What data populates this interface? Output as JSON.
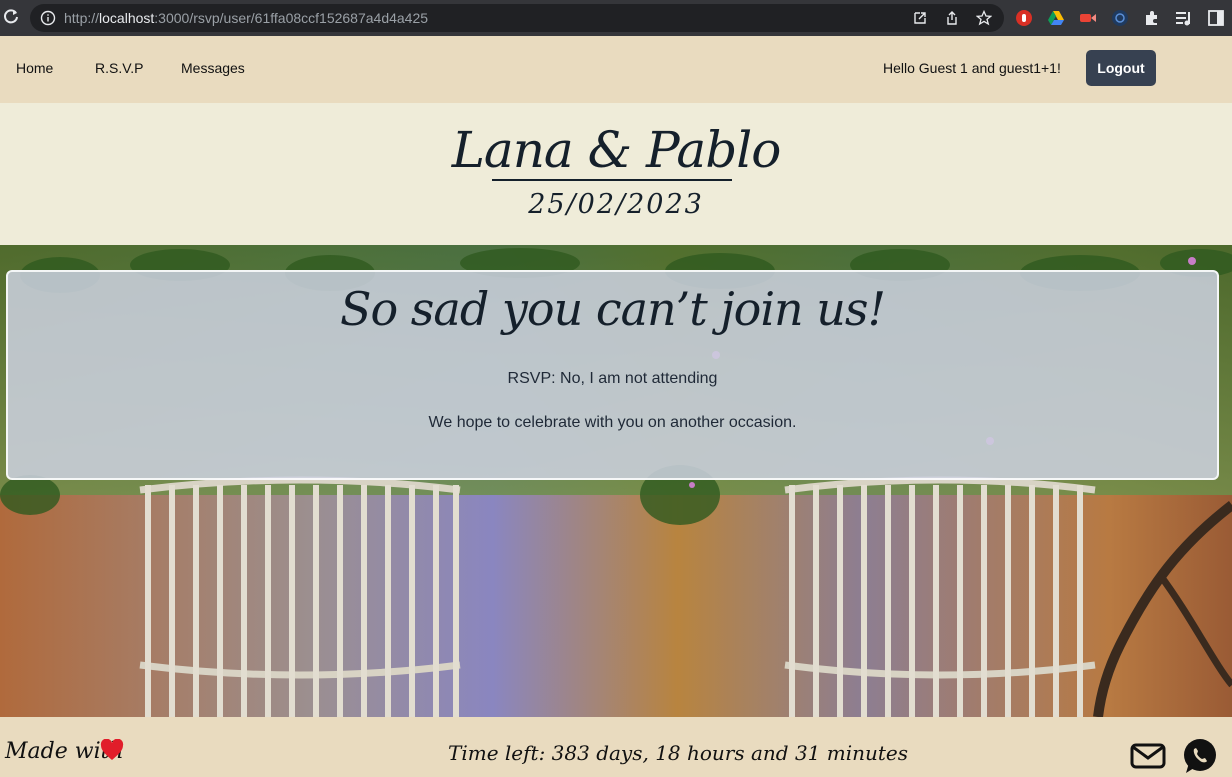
{
  "browser": {
    "url_prefix": "http://",
    "url_host": "localhost",
    "url_rest": ":3000/rsvp/user/61ffa08ccf152687a4d4a425"
  },
  "nav": {
    "links": [
      "Home",
      "R.S.V.P",
      "Messages"
    ],
    "greeting": "Hello Guest 1 and guest1+1!",
    "logout_label": "Logout"
  },
  "header": {
    "couple": "Lana & Pablo",
    "date": "25/02/2023"
  },
  "card": {
    "title": "So sad you can’t join us!",
    "rsvp_status": "RSVP: No, I am not attending",
    "message": "We hope to celebrate with you on another occasion."
  },
  "footer": {
    "made_with": "Made with",
    "time_left": "Time left: 383 days, 18 hours and 31 minutes"
  },
  "colors": {
    "nav_bg": "#e9dbbf",
    "header_bg": "#efecd9",
    "button_bg": "#374151",
    "heart": "#e11d2a"
  }
}
